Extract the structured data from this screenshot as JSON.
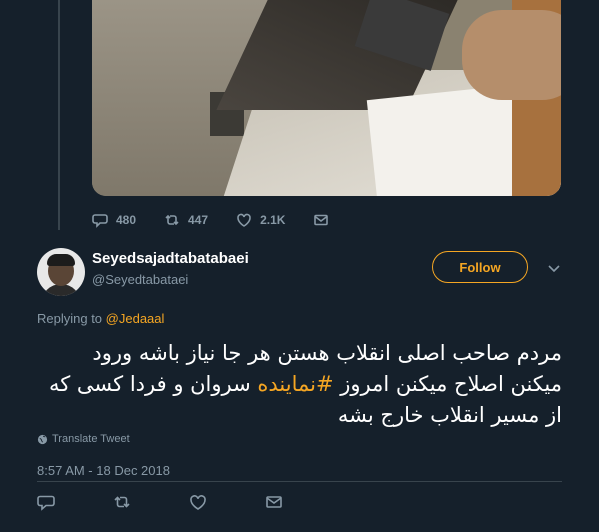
{
  "prev_tweet": {
    "reply_count": "480",
    "retweet_count": "447",
    "like_count": "2.1K"
  },
  "tweet": {
    "author_name": "Seyedsajadtabatabaei",
    "author_handle": "@Seyedtabataei",
    "follow_label": "Follow",
    "replying_prefix": "Replying to",
    "replying_mention": "@Jedaaal",
    "text_part1": "مردم صاحب اصلی انقلاب هستن هر جا نیاز باشه ورود میکنن اصلاح میکنن امروز ",
    "hashtag": "#نماینده",
    "text_part2": " سروان و فردا کسی که از مسیر انقلاب خارج بشه",
    "translate_label": "Translate Tweet",
    "timestamp": "8:57 AM - 18 Dec 2018"
  },
  "colors": {
    "background": "#15202b",
    "accent": "#f5a623",
    "muted": "#8899a6",
    "divider": "#38444d"
  },
  "icons": [
    "reply-icon",
    "retweet-icon",
    "like-icon",
    "message-icon",
    "chevron-down-icon",
    "globe-icon"
  ]
}
